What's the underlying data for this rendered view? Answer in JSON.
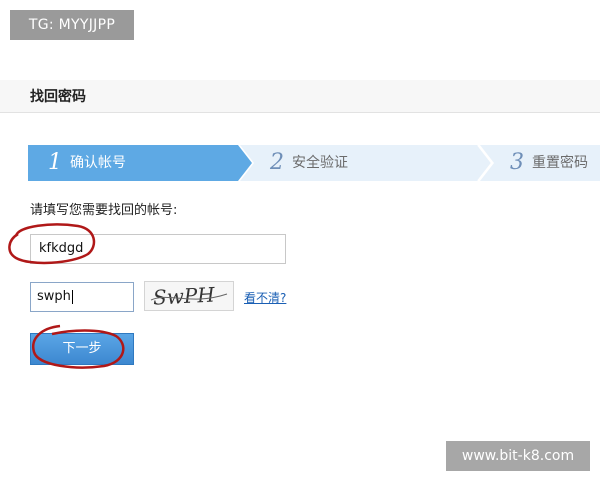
{
  "watermark_top": "TG: MYYJJPP",
  "page": {
    "title": "找回密码"
  },
  "steps": [
    {
      "number": "1",
      "label": "确认帐号",
      "active": true
    },
    {
      "number": "2",
      "label": "安全验证",
      "active": false
    },
    {
      "number": "3",
      "label": "重置密码",
      "active": false
    }
  ],
  "form": {
    "prompt": "请填写您需要找回的帐号:",
    "account_value": "kfkdgd",
    "captcha_value": "swph",
    "captcha_image_text": "SwPH",
    "captcha_refresh_link": "看不清?",
    "next_button": "下一步"
  },
  "colors": {
    "step_active": "#5ea9e4",
    "step_inactive": "#e7f1fa",
    "button": "#4a96da",
    "annotation": "#b01818"
  },
  "watermark_bottom": "www.bit-k8.com"
}
